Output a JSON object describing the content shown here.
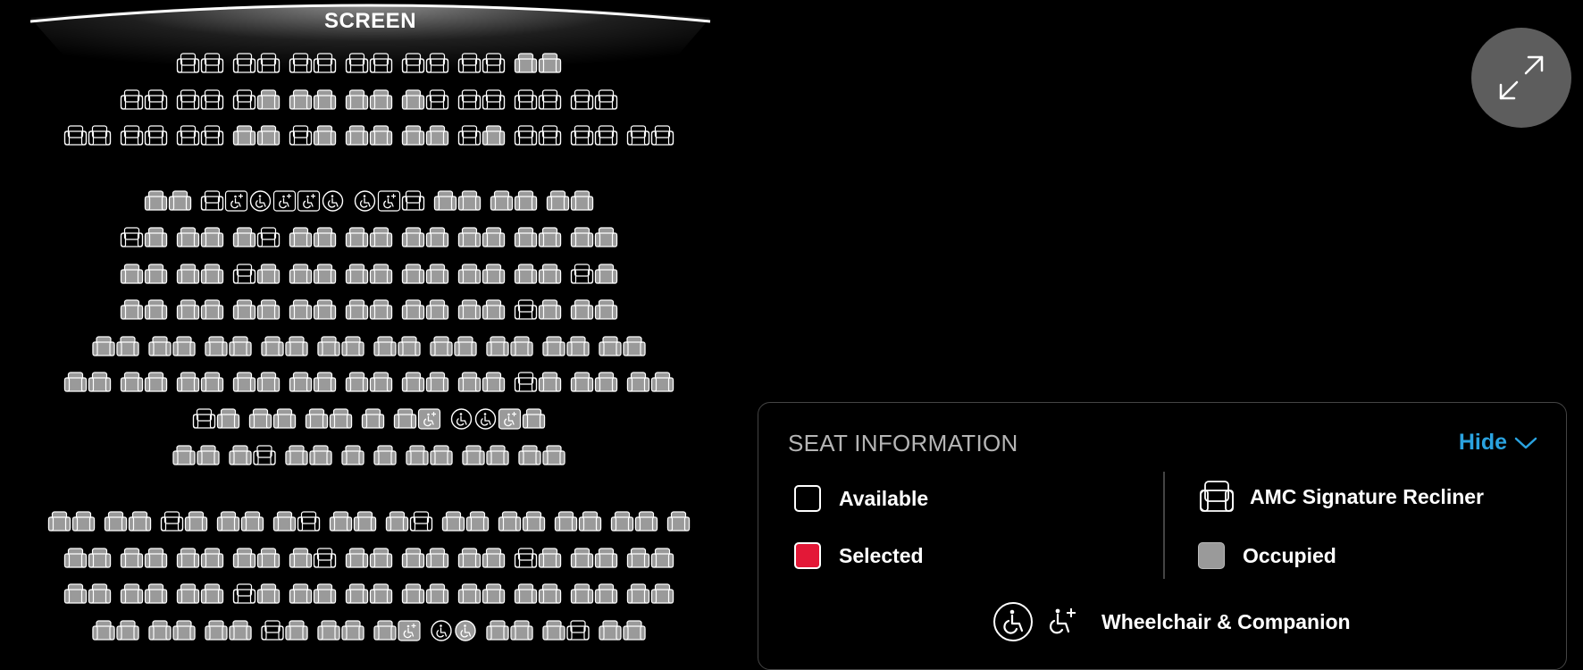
{
  "screen_label": "SCREEN",
  "colors": {
    "background": "#000000",
    "available_outline": "#ffffff",
    "occupied_fill": "#9a9a9a",
    "selected_fill": "#e31837",
    "accent_link": "#2aa3e0",
    "expand_button": "#5d5d5d"
  },
  "expand_button": {
    "icon": "expand-arrows-icon"
  },
  "seat_info": {
    "title": "SEAT INFORMATION",
    "hide_label": "Hide",
    "legend": {
      "available": "Available",
      "selected": "Selected",
      "recliner": "AMC Signature Recliner",
      "occupied": "Occupied",
      "wheelchair": "Wheelchair & Companion"
    }
  },
  "seat_map": {
    "legend_codes": {
      "A": "available recliner",
      "O": "occupied recliner",
      "W": "wheelchair space",
      "G": "wheelchair space (occupied)",
      "C": "companion seat",
      "D": "companion seat (occupied)",
      ".": "gap"
    },
    "rows": [
      {
        "groups": [
          "AA",
          "AA",
          "AA",
          "AA",
          "AA",
          "AA",
          "OO"
        ]
      },
      {
        "groups": [
          "AA",
          "AA",
          "AO",
          "OO",
          "OO",
          "OA",
          "AA",
          "AA",
          "AA"
        ]
      },
      {
        "groups": [
          "AA",
          "AA",
          "AA",
          "OO",
          "AO",
          "OO",
          "OO",
          "AO",
          "AA",
          "AA",
          "AA"
        ]
      },
      {
        "groups": [
          "OO",
          "ACWCCW",
          "WCA",
          "OO",
          "OO",
          "OO"
        ]
      },
      {
        "groups": [
          "AO",
          "OO",
          "OA",
          "OO",
          "OO",
          "OO",
          "OO",
          "OO",
          "OO"
        ]
      },
      {
        "groups": [
          "OO",
          "OO",
          "AO",
          "OO",
          "OO",
          "OO",
          "OO",
          "OO",
          "AO"
        ]
      },
      {
        "groups": [
          "OO",
          "OO",
          "OO",
          "OO",
          "OO",
          "OO",
          "OO",
          "AO",
          "OO"
        ]
      },
      {
        "groups": [
          "OO",
          "OO",
          "OO",
          "OO",
          "OO",
          "OO",
          "OO",
          "OO",
          "OO",
          "OO"
        ]
      },
      {
        "groups": [
          "OO",
          "OO",
          "OO",
          "OO",
          "OO",
          "OO",
          "OO",
          "OO",
          "AO",
          "OO",
          "OO"
        ]
      },
      {
        "groups": [
          "AO",
          "OO",
          "OO",
          "O",
          "OD",
          "WWDO"
        ]
      },
      {
        "groups": [
          "OO",
          "OA",
          "OO",
          "O",
          "O",
          "OO",
          "OO",
          "OO"
        ]
      },
      {
        "groups": [
          "OO",
          "OO",
          "AO",
          "OO",
          "OA",
          "OO",
          "OA",
          "OO",
          "OO",
          "OO",
          "OO",
          "O"
        ]
      },
      {
        "groups": [
          "OO",
          "OO",
          "OO",
          "OO",
          "OA",
          "OO",
          "OO",
          "OO",
          "AO",
          "OO",
          "OO"
        ]
      },
      {
        "groups": [
          "OO",
          "OO",
          "OO",
          "AO",
          "OO",
          "OO",
          "OO",
          "OO",
          "OO",
          "OO",
          "OO"
        ]
      },
      {
        "groups": [
          "OO",
          "OO",
          "OO",
          "AO",
          "OO",
          "OD",
          "WG",
          "OO",
          "OA",
          "OO"
        ]
      }
    ]
  }
}
